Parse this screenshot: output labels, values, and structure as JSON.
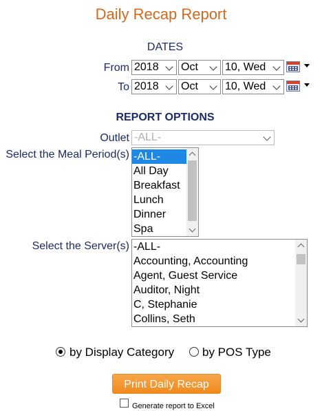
{
  "page": {
    "title": "Daily Recap Report"
  },
  "dates": {
    "heading": "DATES",
    "from_label": "From",
    "to_label": "To",
    "from": {
      "year": "2018",
      "month": "Oct",
      "day": "10, Wed"
    },
    "to": {
      "year": "2018",
      "month": "Oct",
      "day": "10, Wed"
    }
  },
  "report_options": {
    "heading": "REPORT OPTIONS",
    "outlet_label": "Outlet",
    "outlet_value": "-ALL-",
    "meal_label": "Select the Meal Period(s)",
    "meal_items": [
      "-ALL-",
      "All Day",
      "Breakfast",
      "Lunch",
      "Dinner",
      "Spa"
    ],
    "meal_selected": "-ALL-",
    "server_label": "Select the Server(s)",
    "server_items": [
      "-ALL-",
      "Accounting, Accounting",
      "Agent, Guest Service",
      "Auditor, Night",
      "C, Stephanie",
      "Collins, Seth"
    ]
  },
  "grouping": {
    "by_display_category": "by Display Category",
    "by_pos_type": "by POS Type",
    "selected": "by Display Category"
  },
  "actions": {
    "print_label": "Print Daily Recap",
    "excel_label": "Generate report to Excel",
    "excel_checked": false
  }
}
